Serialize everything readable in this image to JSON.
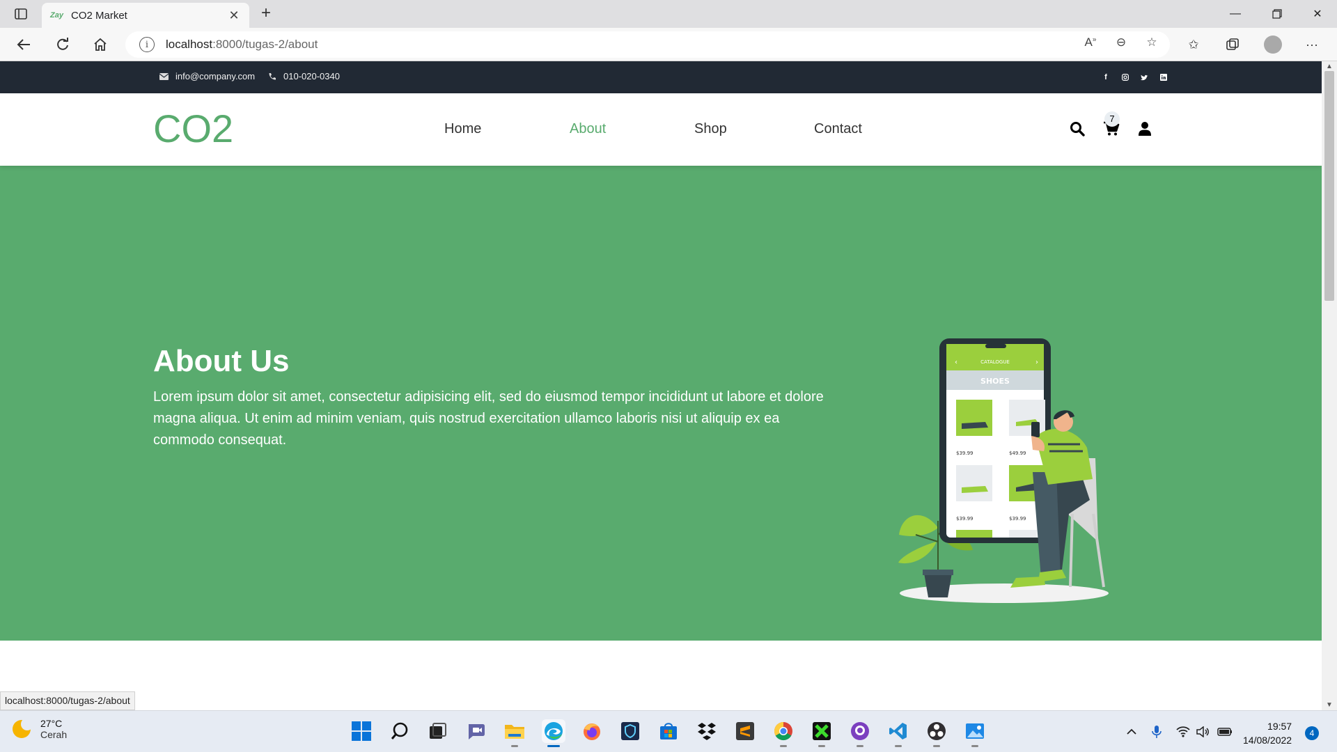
{
  "browser": {
    "tab": {
      "favicon_text": "Zay",
      "title": "CO2 Market"
    },
    "address": {
      "host": "localhost",
      "rest": ":8000/tugas-2/about"
    }
  },
  "site": {
    "topbar": {
      "email": "info@company.com",
      "phone": "010-020-0340",
      "social": [
        "facebook-icon",
        "instagram-icon",
        "twitter-icon",
        "linkedin-icon"
      ]
    },
    "logo": "CO2",
    "nav": {
      "home": "Home",
      "about": "About",
      "shop": "Shop",
      "contact": "Contact"
    },
    "cart_count": "7",
    "hero": {
      "title": "About Us",
      "text": "Lorem ipsum dolor sit amet, consectetur adipisicing elit, sed do eiusmod tempor incididunt ut labore et dolore magna aliqua. Ut enim ad minim veniam, quis nostrud exercitation ullamco laboris nisi ut aliquip ex ea commodo consequat.",
      "illustration": {
        "header": "CATALOGUE",
        "category": "SHOES",
        "prices": [
          "$39.99",
          "$49.99",
          "$39.99",
          "$39.99"
        ]
      }
    },
    "colors": {
      "accent": "#59ab6e",
      "topbar": "#212934"
    }
  },
  "statusbar": {
    "url": "localhost:8000/tugas-2/about"
  },
  "taskbar": {
    "weather": {
      "temp": "27°C",
      "desc": "Cerah"
    },
    "clock": {
      "time": "19:57",
      "date": "14/08/2022"
    },
    "notifications": "4"
  }
}
